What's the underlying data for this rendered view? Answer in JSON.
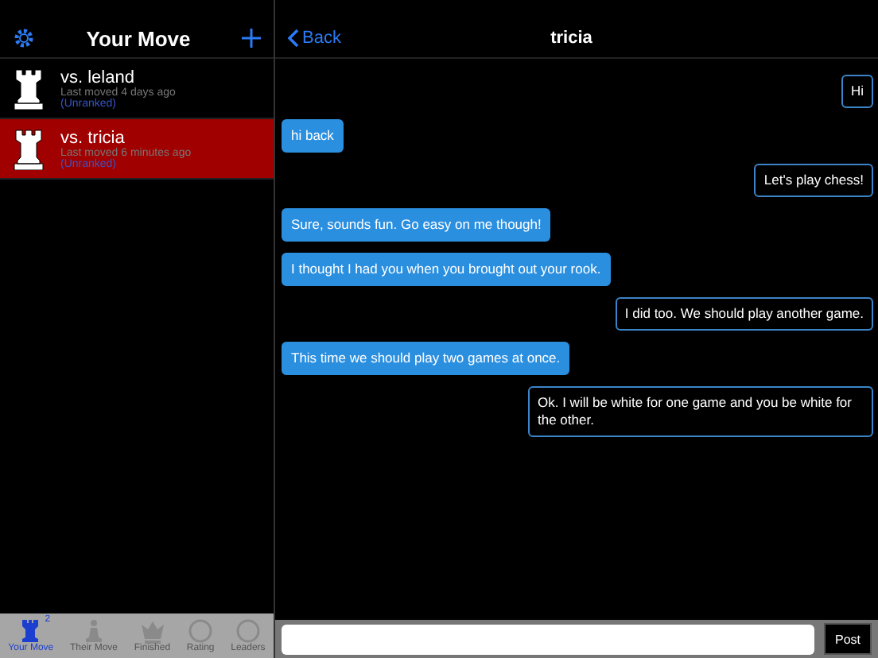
{
  "sidebar": {
    "title": "Your Move",
    "games": [
      {
        "opponent": "vs. leland",
        "subtitle": "Last moved 4 days ago",
        "rating": "(Unranked)",
        "selected": false
      },
      {
        "opponent": "vs. tricia",
        "subtitle": "Last moved 6 minutes ago",
        "rating": "(Unranked)",
        "selected": true
      }
    ]
  },
  "tab_bar": [
    {
      "label": "Your Move",
      "badge": "2",
      "selected": true
    },
    {
      "label": "Their Move",
      "selected": false
    },
    {
      "label": "Finished",
      "selected": false
    },
    {
      "label": "Rating",
      "selected": false
    },
    {
      "label": "Leaders",
      "selected": false
    }
  ],
  "chat": {
    "back": "Back",
    "title": "tricia",
    "messages": [
      {
        "kind": "outgoing",
        "text": "Hi"
      },
      {
        "kind": "incoming",
        "text": "hi back"
      },
      {
        "kind": "outgoing",
        "text": "Let's play chess!"
      },
      {
        "kind": "incoming",
        "text": "Sure, sounds fun. Go easy on me though!"
      },
      {
        "kind": "incoming",
        "text": "I thought I had you when you brought out your rook."
      },
      {
        "kind": "outgoing",
        "text": "I did too.  We should play another game."
      },
      {
        "kind": "incoming",
        "text": "This time we should play two games at once."
      },
      {
        "kind": "outgoing",
        "text": "Ok.  I will be white for one game and you be white for the other."
      }
    ],
    "post": "Post"
  }
}
